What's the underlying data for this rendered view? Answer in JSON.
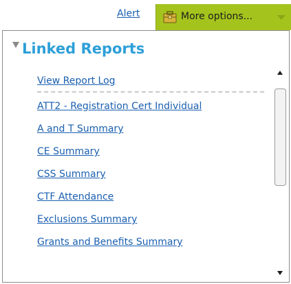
{
  "toolbar": {
    "alert_label": "Alert",
    "more_options_label": "More options...",
    "accent_color": "#a4c41d"
  },
  "panel": {
    "title": "Linked Reports",
    "title_color": "#2d9fd8",
    "collapse_icon": "triangle-down-icon",
    "report_log_label": "View Report Log",
    "reports": [
      "ATT2 - Registration Cert Individual",
      "A and T Summary",
      "CE Summary",
      "CSS Summary",
      "CTF Attendance",
      "Exclusions Summary",
      "Grants and Benefits Summary"
    ]
  },
  "icons": {
    "briefcase": "briefcase-icon",
    "dropdown": "chevron-down-icon",
    "scroll_up": "arrow-up-icon",
    "scroll_down": "arrow-down-icon"
  }
}
